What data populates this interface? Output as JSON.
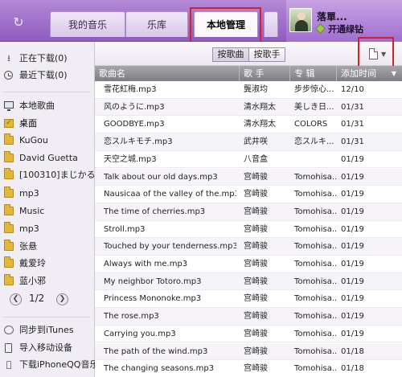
{
  "app": {
    "refresh_icon": "refresh-icon",
    "tabs": [
      {
        "label": "我的音乐",
        "active": false
      },
      {
        "label": "乐库",
        "active": false
      },
      {
        "label": "本地管理",
        "active": true
      }
    ],
    "highlight_color": "#d6202a"
  },
  "user": {
    "name": "落單...",
    "vip_label": "开通绿钻"
  },
  "sidebar": {
    "items": [
      {
        "label": "正在下载(0)",
        "icon": "download-icon"
      },
      {
        "label": "最近下载(0)",
        "icon": "clock-icon"
      },
      {
        "label": "本地歌曲",
        "icon": "monitor-icon"
      },
      {
        "label": "桌面",
        "icon": "checked-folder-icon"
      },
      {
        "label": "KuGou",
        "icon": "folder-icon"
      },
      {
        "label": "David Guetta",
        "icon": "folder-icon"
      },
      {
        "label": "[100310]まじかる",
        "icon": "folder-icon"
      },
      {
        "label": "mp3",
        "icon": "folder-icon"
      },
      {
        "label": "Music",
        "icon": "folder-icon"
      },
      {
        "label": "mp3",
        "icon": "folder-icon"
      },
      {
        "label": "张悬",
        "icon": "folder-icon"
      },
      {
        "label": "戴爱玲",
        "icon": "folder-icon"
      },
      {
        "label": "蓝小邪",
        "icon": "folder-icon"
      }
    ],
    "pager": {
      "current": 1,
      "total": 2,
      "text": "1/2"
    },
    "bottom": [
      {
        "label": "同步到iTunes",
        "icon": "sync-icon"
      },
      {
        "label": "导入移动设备",
        "icon": "device-icon"
      },
      {
        "label": "下载iPhoneQQ音乐",
        "icon": "apple-icon"
      }
    ]
  },
  "toolbar": {
    "by_song": "按歌曲",
    "by_singer": "按歌手"
  },
  "table": {
    "headers": {
      "song": "歌曲名",
      "singer": "歌 手",
      "album": "专 辑",
      "added": "添加时间"
    },
    "rows": [
      {
        "song": "雪花紅梅.mp3",
        "singer": "龔淑均",
        "album": "步步惊心...",
        "added": "12/10"
      },
      {
        "song": "风のように.mp3",
        "singer": "清水翔太",
        "album": "美しき日...",
        "added": "01/31"
      },
      {
        "song": "GOODBYE.mp3",
        "singer": "清水翔太",
        "album": "COLORS",
        "added": "01/31"
      },
      {
        "song": "恋スルキモチ.mp3",
        "singer": "武井咲",
        "album": "恋スルキ...",
        "added": "01/31"
      },
      {
        "song": "天空之城.mp3",
        "singer": "八音盒",
        "album": "",
        "added": "01/19"
      },
      {
        "song": "Talk about our old days.mp3",
        "singer": "宫崎骏",
        "album": "Tomohisa...",
        "added": "01/19"
      },
      {
        "song": "Nausicaa of the valley of the.mp3",
        "singer": "宫崎骏",
        "album": "Tomohisa...",
        "added": "01/19"
      },
      {
        "song": "The time of cherries.mp3",
        "singer": "宫崎骏",
        "album": "Tomohisa...",
        "added": "01/19"
      },
      {
        "song": "Stroll.mp3",
        "singer": "宫崎骏",
        "album": "Tomohisa...",
        "added": "01/19"
      },
      {
        "song": "Touched by your tenderness.mp3",
        "singer": "宫崎骏",
        "album": "Tomohisa...",
        "added": "01/19"
      },
      {
        "song": "Always with me.mp3",
        "singer": "宫崎骏",
        "album": "Tomohisa...",
        "added": "01/19"
      },
      {
        "song": "My neighbor Totoro.mp3",
        "singer": "宫崎骏",
        "album": "Tomohisa...",
        "added": "01/19"
      },
      {
        "song": "Princess Mononoke.mp3",
        "singer": "宫崎骏",
        "album": "Tomohisa...",
        "added": "01/19"
      },
      {
        "song": "The rose.mp3",
        "singer": "宫崎骏",
        "album": "Tomohisa...",
        "added": "01/19"
      },
      {
        "song": "Carrying you.mp3",
        "singer": "宫崎骏",
        "album": "Tomohisa...",
        "added": "01/19"
      },
      {
        "song": "The path of the wind.mp3",
        "singer": "宫崎骏",
        "album": "Tomohisa...",
        "added": "01/18"
      },
      {
        "song": "The changing seasons.mp3",
        "singer": "宫崎骏",
        "album": "Tomohisa...",
        "added": "01/18"
      }
    ]
  }
}
